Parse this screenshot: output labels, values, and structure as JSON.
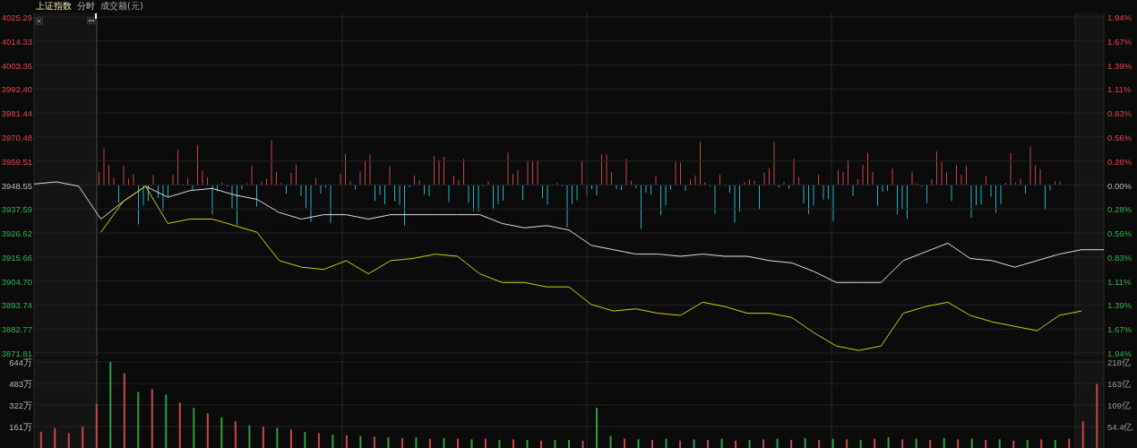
{
  "header": {
    "title": "上证指数",
    "mode": "分时",
    "indicator": "成交额(元)"
  },
  "price_chart": {
    "chart_data": {
      "type": "line",
      "grid": true,
      "ylim": [
        3871.81,
        4025.29
      ],
      "yticks": [
        {
          "value": 4025.29,
          "label": "4025.29"
        },
        {
          "value": 4014.33,
          "label": "4014.33"
        },
        {
          "value": 4003.36,
          "label": "4003.36"
        },
        {
          "value": 3992.4,
          "label": "3992.40"
        },
        {
          "value": 3981.44,
          "label": "3981.44"
        },
        {
          "value": 3970.48,
          "label": "3970.48"
        },
        {
          "value": 3959.51,
          "label": "3959.51"
        },
        {
          "value": 3948.55,
          "label": "3948.55"
        },
        {
          "value": 3937.59,
          "label": "3937.59"
        },
        {
          "value": 3926.62,
          "label": "3926.62"
        },
        {
          "value": 3915.66,
          "label": "3915.66"
        },
        {
          "value": 3904.7,
          "label": "3904.70"
        },
        {
          "value": 3893.74,
          "label": "3893.74"
        },
        {
          "value": 3882.77,
          "label": "3882.77"
        },
        {
          "value": 3871.81,
          "label": "3871.81"
        }
      ],
      "series": [
        {
          "color": "#e0e0e0",
          "values": [
            3949,
            3950,
            3948,
            3933,
            3941,
            3948,
            3943,
            3946,
            3947,
            3944,
            3942,
            3936,
            3933,
            3935,
            3935,
            3933,
            3935,
            3935,
            3935,
            3935,
            3935,
            3931,
            3929,
            3930,
            3928,
            3921,
            3919,
            3917,
            3917,
            3916,
            3917,
            3916,
            3916,
            3914,
            3913,
            3909,
            3904,
            3904,
            3904,
            3914,
            3918,
            3922,
            3915,
            3914,
            3911,
            3914,
            3917,
            3919,
            3919
          ]
        },
        {
          "color": "#d2d200",
          "values": [
            null,
            null,
            null,
            3927,
            3941,
            3948,
            3931,
            3933,
            3933,
            3930,
            3927,
            3914,
            3911,
            3910,
            3914,
            3908,
            3914,
            3915,
            3917,
            3916,
            3908,
            3904,
            3904,
            3902,
            3902,
            3894,
            3891,
            3892,
            3890,
            3889,
            3895,
            3893,
            3890,
            3890,
            3888,
            3881,
            3875,
            3873,
            3875,
            3890,
            3893,
            3895,
            3889,
            3886,
            3884,
            3882,
            3889,
            3891,
            null
          ]
        }
      ]
    },
    "right_axis": [
      "1.94%",
      "1.67%",
      "1.39%",
      "1.11%",
      "0.83%",
      "0.56%",
      "0.28%",
      "0.00%",
      "0.28%",
      "0.56%",
      "0.83%",
      "1.11%",
      "1.39%",
      "1.67%",
      "1.94%"
    ]
  },
  "volume_chart": {
    "chart_data": {
      "type": "bar",
      "grid": true,
      "ylim": [
        0,
        644
      ],
      "yticks": [
        {
          "value": 644,
          "label": "644万"
        },
        {
          "value": 483,
          "label": "483万"
        },
        {
          "value": 322,
          "label": "322万"
        },
        {
          "value": 161,
          "label": "161万"
        }
      ],
      "series": [
        {
          "color": "#c84848",
          "values": [
            120,
            150,
            110,
            160,
            330,
            null,
            560,
            null,
            440,
            null,
            340,
            null,
            260,
            null,
            200,
            null,
            160,
            null,
            140,
            null,
            110,
            null,
            95,
            null,
            85,
            null,
            75,
            null,
            70,
            null,
            70,
            null,
            70,
            null,
            65,
            null,
            55,
            null,
            null,
            55,
            null,
            null,
            70,
            null,
            60,
            null,
            55,
            null,
            60,
            null,
            55,
            null,
            65,
            null,
            60,
            null,
            60,
            null,
            65,
            null,
            70,
            null,
            65,
            null,
            60,
            null,
            65,
            null,
            60,
            null,
            55,
            null,
            65,
            null,
            70,
            200,
            480
          ]
        },
        {
          "color": "#2ea043",
          "values": [
            null,
            null,
            null,
            null,
            null,
            644,
            null,
            420,
            null,
            400,
            null,
            300,
            null,
            230,
            null,
            170,
            null,
            150,
            null,
            120,
            null,
            100,
            null,
            90,
            null,
            80,
            null,
            80,
            null,
            75,
            null,
            65,
            null,
            60,
            null,
            60,
            null,
            60,
            60,
            null,
            300,
            90,
            null,
            65,
            null,
            70,
            null,
            65,
            null,
            70,
            null,
            60,
            null,
            70,
            null,
            75,
            null,
            70,
            null,
            60,
            null,
            80,
            null,
            70,
            null,
            75,
            null,
            70,
            null,
            65,
            null,
            60,
            null,
            60,
            null,
            null,
            null
          ]
        }
      ]
    },
    "right_axis": [
      "218亿",
      "163亿",
      "109亿",
      "54.4亿"
    ]
  }
}
